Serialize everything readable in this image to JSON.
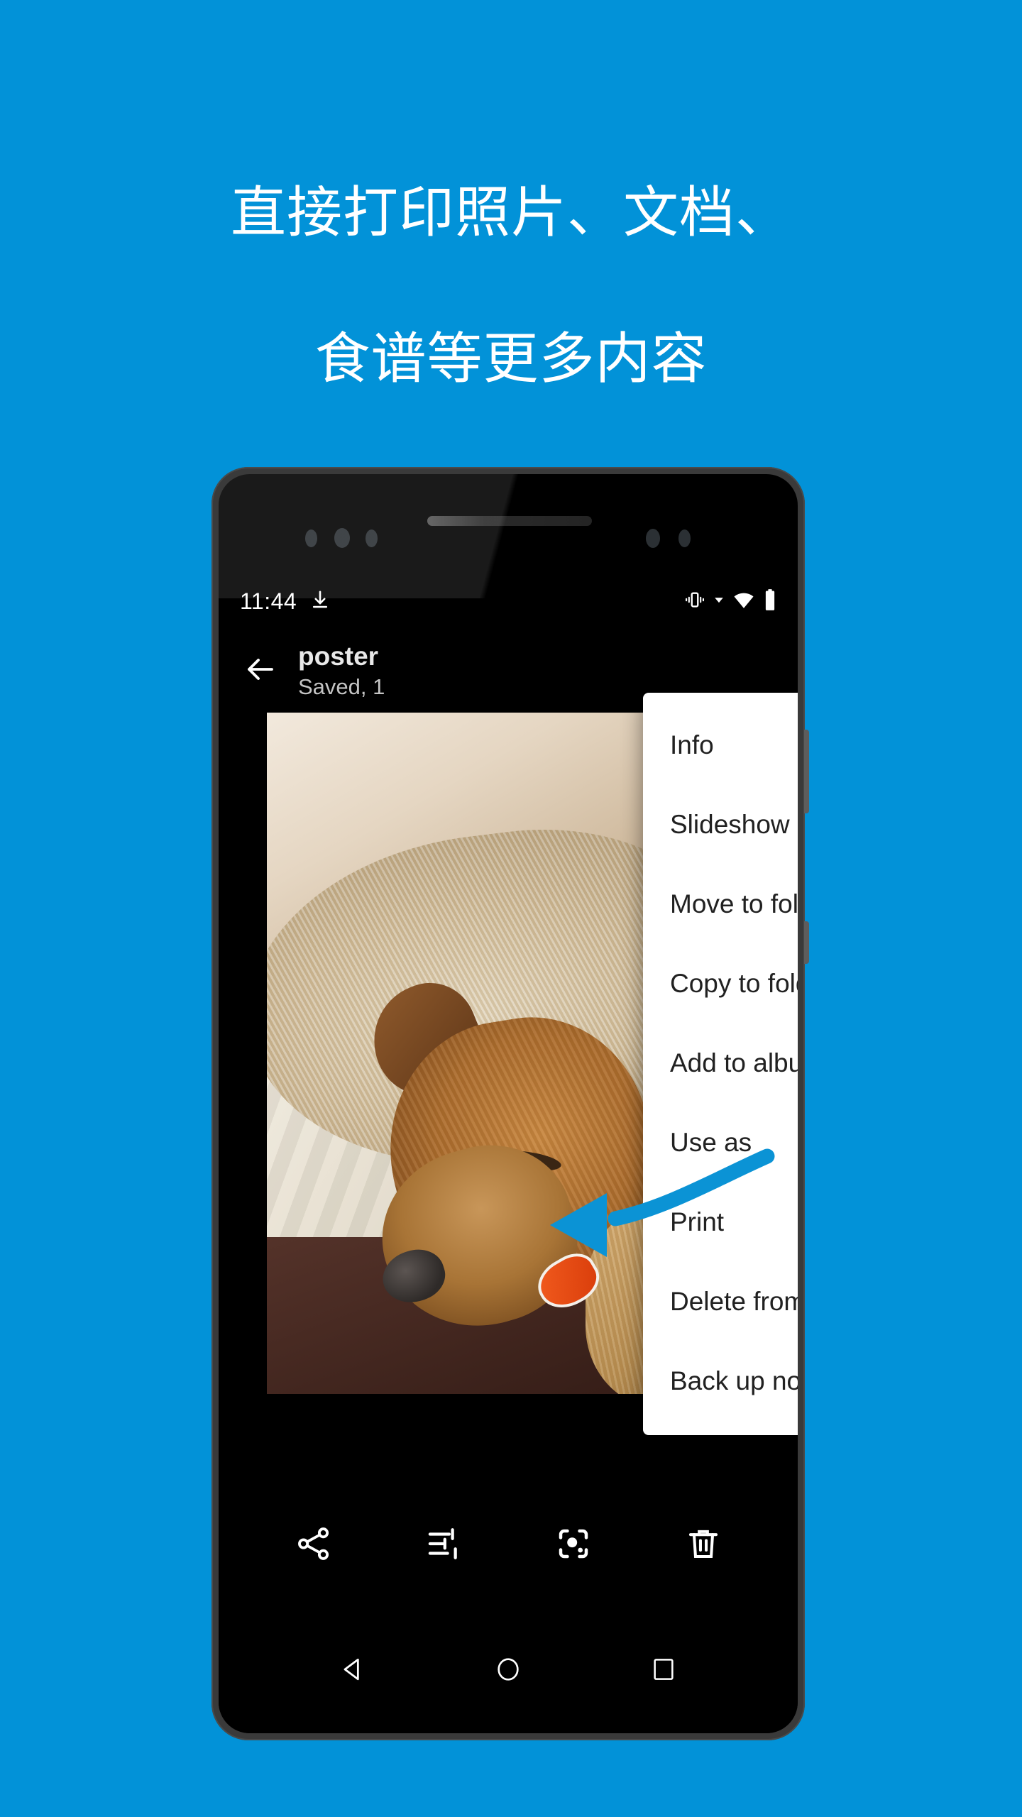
{
  "theme": {
    "background_blue": "#0292d8",
    "arrow_blue": "#0b93d5",
    "menu_background": "#ffffff",
    "menu_text": "#212121",
    "screen_background": "#000000"
  },
  "headline": {
    "line1": "直接打印照片、文档、",
    "line2": "食谱等更多内容"
  },
  "phone": {
    "status_bar": {
      "clock": "11:44",
      "icons": [
        "download-icon",
        "vibrate-icon",
        "wifi-icon",
        "battery-icon"
      ]
    },
    "app_bar": {
      "back_icon": "arrow-back-icon",
      "title": "poster",
      "subtitle": "Saved, 1"
    },
    "photo": {
      "alt": "sleeping dog resting beside blonde child on a pillow"
    },
    "menu": {
      "items": [
        {
          "label": "Info"
        },
        {
          "label": "Slideshow"
        },
        {
          "label": "Move to folder"
        },
        {
          "label": "Copy to folder"
        },
        {
          "label": "Add to album"
        },
        {
          "label": "Use as"
        },
        {
          "label": "Print"
        },
        {
          "label": "Delete from device"
        },
        {
          "label": "Back up now"
        }
      ],
      "highlighted_item": "Print"
    },
    "toolbar": {
      "buttons": [
        {
          "name": "share-icon",
          "label": "Share"
        },
        {
          "name": "edit-icon",
          "label": "Edit"
        },
        {
          "name": "lens-icon",
          "label": "Lens"
        },
        {
          "name": "delete-icon",
          "label": "Delete"
        }
      ]
    },
    "navigation_bar": {
      "buttons": [
        {
          "name": "nav-back-icon",
          "label": "Back"
        },
        {
          "name": "nav-home-icon",
          "label": "Home"
        },
        {
          "name": "nav-recents-icon",
          "label": "Recents"
        }
      ]
    }
  }
}
